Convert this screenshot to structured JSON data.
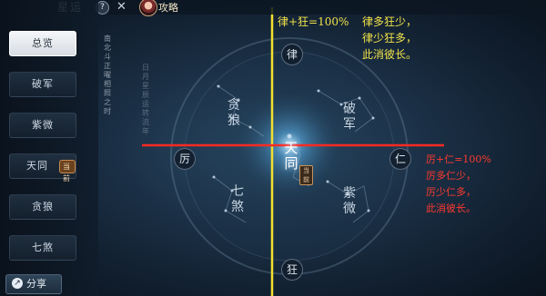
{
  "header": {
    "title": "星运",
    "help_glyph": "?",
    "close_glyph": "✕",
    "guide_label": "攻略"
  },
  "sidebar": {
    "items": [
      {
        "label": "总览",
        "active": true
      },
      {
        "label": "破军"
      },
      {
        "label": "紫微"
      },
      {
        "label": "天同",
        "badge": "当前"
      },
      {
        "label": "贪狼"
      },
      {
        "label": "七煞"
      }
    ],
    "share_label": "分享"
  },
  "poem_columns": [
    "南北斗正曜相照之时",
    "日月星辰运转流年"
  ],
  "plate": {
    "ring_labels": {
      "top": "律",
      "bottom": "狂",
      "left": "厉",
      "right": "仁"
    },
    "stars": {
      "upper_left": "贪狼",
      "upper_right": "破军",
      "lower_left": "七煞",
      "lower_right": "紫微",
      "center": "天同"
    },
    "current_tag": "当前"
  },
  "annotations": {
    "vertical_title": "律+狂=100%",
    "vertical_lines": [
      "律多狂少，",
      "律少狂多，",
      "此消彼长。"
    ],
    "horizontal_title": "厉+仁=100%",
    "horizontal_lines": [
      "厉多仁少，",
      "厉少仁多，",
      "此消彼长。"
    ]
  },
  "colors": {
    "vertical_axis": "#f2e02e",
    "horizontal_axis": "#ff2a22",
    "active_nav": "#eef1f4"
  }
}
